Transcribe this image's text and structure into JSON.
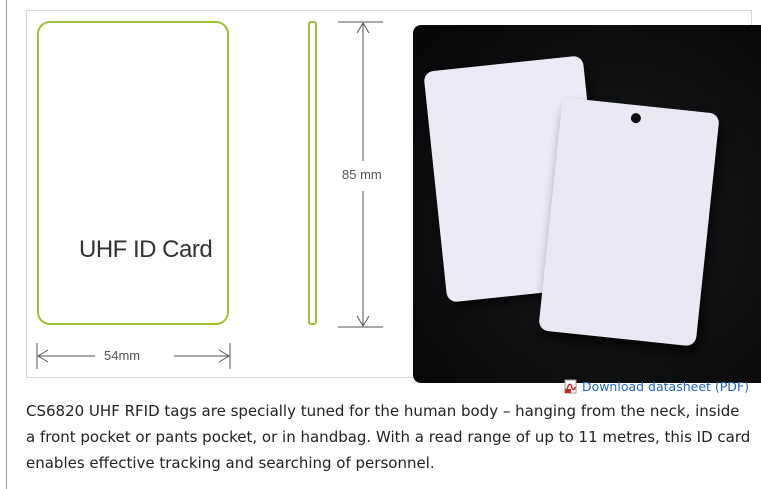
{
  "figure": {
    "card_label": "UHF ID Card",
    "width_label": "54mm",
    "height_label": "85 mm",
    "outline_color": "#9fc03a",
    "dimension_line_color": "#555555"
  },
  "download": {
    "icon": "pdf-icon",
    "label": "Download datasheet (PDF)",
    "color": "#2266bb"
  },
  "description": "CS6820 UHF RFID tags are specially tuned for the human body – hanging from the neck, inside a front pocket or pants pocket, or in handbag. With a read range of up to 11 metres, this ID card enables effective tracking and searching of personnel."
}
